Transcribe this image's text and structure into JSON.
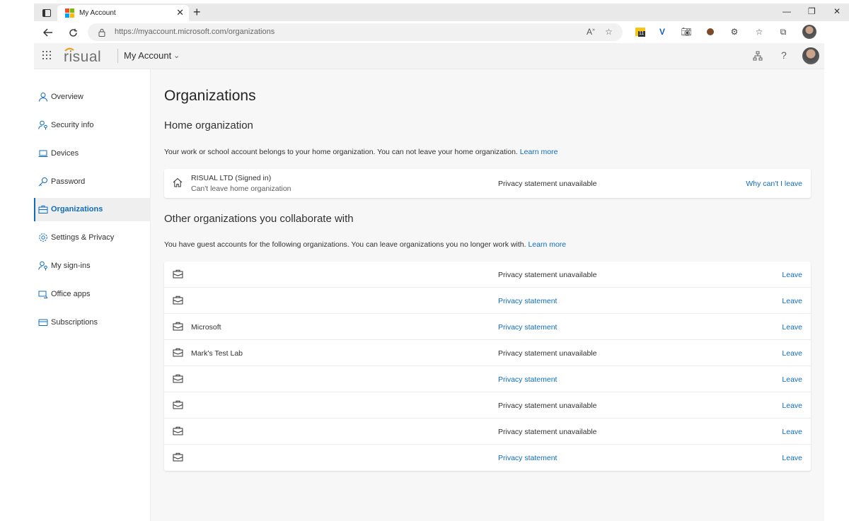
{
  "browser": {
    "tab_title": "My Account",
    "tab_close": "✕",
    "new_tab": "+",
    "url": "https://myaccount.microsoft.com/organizations",
    "extension_badge": "11"
  },
  "app": {
    "logo_text": "risual",
    "name": "My Account"
  },
  "nav": {
    "items": [
      {
        "label": "Overview",
        "icon": "person-icon"
      },
      {
        "label": "Security info",
        "icon": "person-key-icon"
      },
      {
        "label": "Devices",
        "icon": "laptop-icon"
      },
      {
        "label": "Password",
        "icon": "key-icon"
      },
      {
        "label": "Organizations",
        "icon": "briefcase-icon",
        "active": true
      },
      {
        "label": "Settings & Privacy",
        "icon": "gear-icon"
      },
      {
        "label": "My sign-ins",
        "icon": "person-key-icon"
      },
      {
        "label": "Office apps",
        "icon": "office-apps-icon"
      },
      {
        "label": "Subscriptions",
        "icon": "card-icon"
      }
    ]
  },
  "page": {
    "title": "Organizations",
    "home": {
      "heading": "Home organization",
      "description": "Your work or school account belongs to your home organization. You can not leave your home organization.",
      "learn_more": "Learn more",
      "org_name": "RISUAL LTD (Signed in)",
      "org_sub": "Can't leave home organization",
      "privacy": "Privacy statement unavailable",
      "action": "Why can't I leave"
    },
    "other": {
      "heading": "Other organizations you collaborate with",
      "description": "You have guest accounts for the following organizations. You can leave organizations you no longer work with.",
      "learn_more": "Learn more",
      "leave_label": "Leave",
      "rows": [
        {
          "name": "",
          "privacy": "Privacy statement unavailable",
          "privacy_is_link": false
        },
        {
          "name": "",
          "privacy": "Privacy statement",
          "privacy_is_link": true
        },
        {
          "name": "Microsoft",
          "privacy": "Privacy statement",
          "privacy_is_link": true
        },
        {
          "name": "Mark's Test Lab",
          "privacy": "Privacy statement unavailable",
          "privacy_is_link": false
        },
        {
          "name": "",
          "privacy": "Privacy statement",
          "privacy_is_link": true
        },
        {
          "name": "",
          "privacy": "Privacy statement unavailable",
          "privacy_is_link": false
        },
        {
          "name": "",
          "privacy": "Privacy statement unavailable",
          "privacy_is_link": false
        },
        {
          "name": "",
          "privacy": "Privacy statement",
          "privacy_is_link": true
        }
      ]
    }
  },
  "colors": {
    "accent": "#0f6cbd",
    "logo_orange": "#e8a31e",
    "logo_grey": "#707070"
  }
}
